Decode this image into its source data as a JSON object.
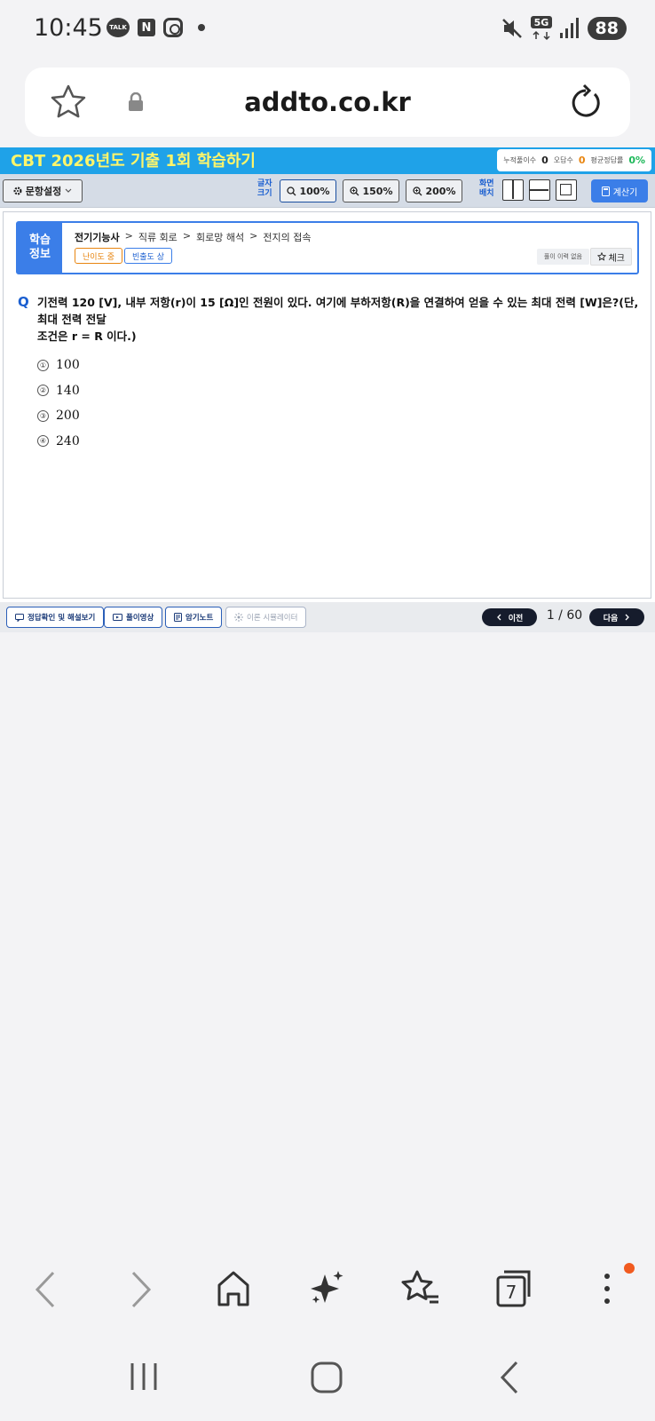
{
  "status_bar": {
    "time": "10:45",
    "talk_label": "TALK",
    "n_label": "N",
    "network": "5G",
    "battery": "88"
  },
  "url_bar": {
    "url": "addto.co.kr"
  },
  "header": {
    "title": "CBT 2026년도 기출 1회 학습하기",
    "stats": {
      "cumulative_label": "누적풀이수",
      "cumulative_value": "0",
      "wrong_label": "오답수",
      "wrong_value": "0",
      "avg_label": "평균정답률",
      "avg_value": "0%"
    }
  },
  "toolbar": {
    "settings_label": "문항설정",
    "font_size_label_1": "글자",
    "font_size_label_2": "크기",
    "zoom_options": [
      "100%",
      "150%",
      "200%"
    ],
    "layout_label_1": "화면",
    "layout_label_2": "배치",
    "calculator_label": "계산기"
  },
  "info": {
    "side_label_1": "학습",
    "side_label_2": "정보",
    "breadcrumb": [
      "전기기능사",
      "직류 회로",
      "회로망 해석",
      "전지의 접속"
    ],
    "separator": ">",
    "difficulty_tag": "난이도 중",
    "frequency_tag": "빈출도 상",
    "history_label": "풀이 이력 없음",
    "check_label": "체크"
  },
  "question": {
    "marker": "Q",
    "line1": "기전력 120 [V], 내부 저항(r)이 15 [Ω]인 전원이 있다. 여기에 부하저항(R)을 연결하여 얻을 수 있는 최대 전력 [W]은?(단, 최대 전력 전달",
    "line2": "조건은 r = R 이다.)"
  },
  "choices": [
    {
      "num": "①",
      "text": "100"
    },
    {
      "num": "②",
      "text": "140"
    },
    {
      "num": "③",
      "text": "200"
    },
    {
      "num": "④",
      "text": "240"
    }
  ],
  "bottom_bar": {
    "answer_label": "정답확인 및 해설보기",
    "video_label": "풀이영상",
    "note_label": "암기노트",
    "simulator_label": "이론 시뮬레이터",
    "prev_label": "이전",
    "next_label": "다음",
    "page": "1 / 60"
  },
  "browser_nav": {
    "tabs_count": "7"
  },
  "colors": {
    "title_bar": "#1fa2e8",
    "title_text": "#fff56a",
    "accent_blue": "#3b7ee8",
    "orange": "#e88510",
    "green": "#1eb85a",
    "nav_dark": "#161c2c"
  }
}
